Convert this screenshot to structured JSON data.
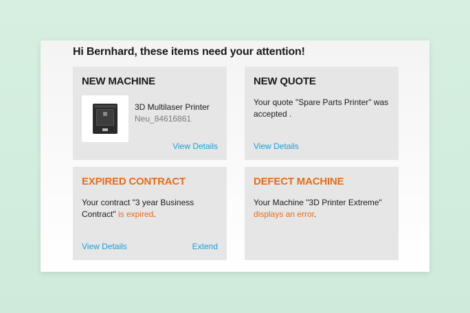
{
  "headline": "Hi Bernhard, these items need your attention!",
  "cards": {
    "new_machine": {
      "title": "NEW MACHINE",
      "machine_name": "3D Multilaser Printer",
      "machine_id": "Neu_84616861",
      "link": "View Details"
    },
    "new_quote": {
      "title": "NEW QUOTE",
      "text": "Your quote \"Spare Parts Printer\" was accepted .",
      "link": "View Details"
    },
    "expired_contract": {
      "title": "EXPIRED CONTRACT",
      "text_before": "Your contract \"3 year Business Contract\" ",
      "text_highlight": "is expired",
      "text_after": ".",
      "link": "View Details",
      "secondary_link": "Extend"
    },
    "defect_machine": {
      "title": "DEFECT MACHINE",
      "text_before": "Your Machine \"3D Printer Extreme\" ",
      "text_highlight": "displays an error",
      "text_after": ".",
      "link": ""
    }
  },
  "colors": {
    "accent_orange": "#ea6b16",
    "link_blue": "#1a9fd5",
    "card_bg": "#e6e6e6",
    "page_bg": "#d6efe0"
  }
}
